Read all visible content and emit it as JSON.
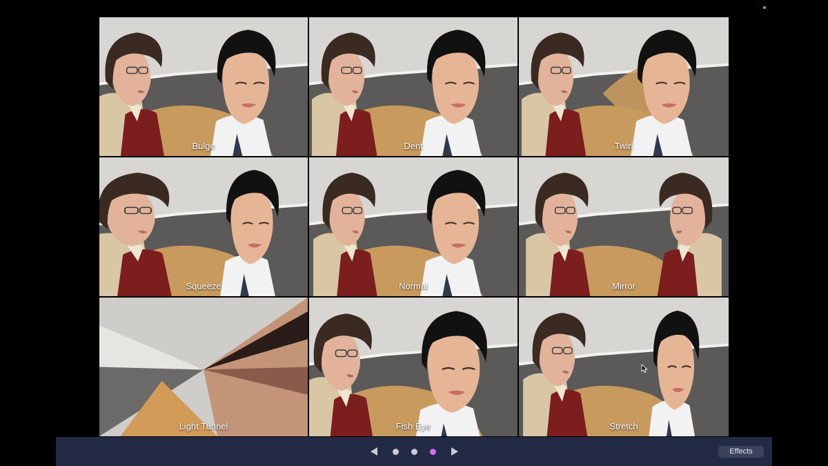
{
  "app": {
    "accent_color": "#d66df2",
    "bar_color": "#222a45"
  },
  "effects": [
    {
      "label": "Bulge",
      "effect": "bulge"
    },
    {
      "label": "Dent",
      "effect": "dent"
    },
    {
      "label": "Twirl",
      "effect": "twirl"
    },
    {
      "label": "Squeeze",
      "effect": "squeeze"
    },
    {
      "label": "Normal",
      "effect": "normal"
    },
    {
      "label": "Mirror",
      "effect": "mirror"
    },
    {
      "label": "Light Tunnel",
      "effect": "light-tunnel"
    },
    {
      "label": "Fish Eye",
      "effect": "fish-eye"
    },
    {
      "label": "Stretch",
      "effect": "stretch"
    }
  ],
  "pager": {
    "prev_icon": "arrow-left-icon",
    "next_icon": "arrow-right-icon",
    "page_count": 3,
    "current_page": 3
  },
  "toolbar": {
    "effects_label": "Effects"
  }
}
